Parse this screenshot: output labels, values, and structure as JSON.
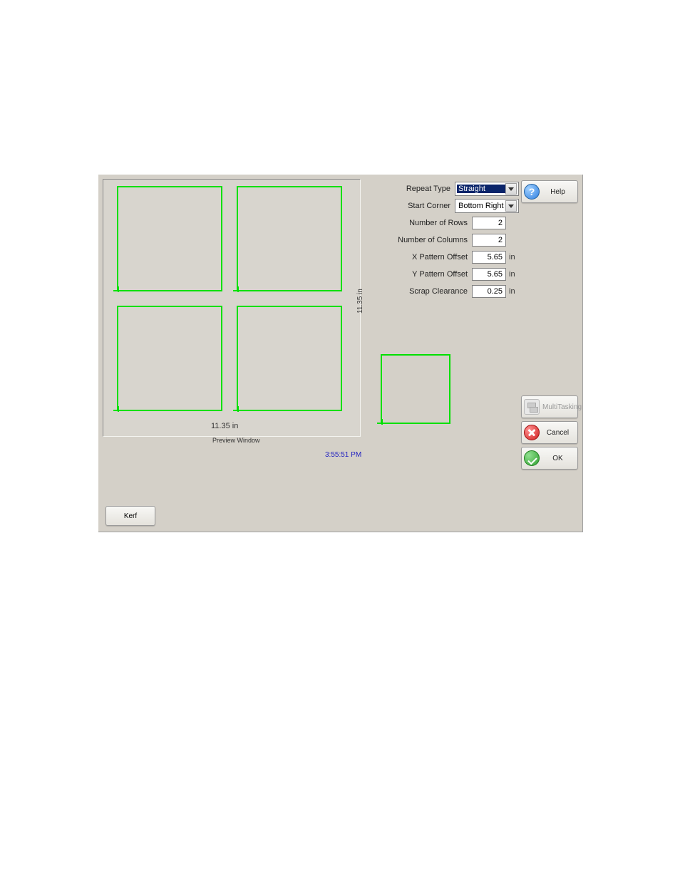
{
  "preview": {
    "x_dimension": "11.35 in",
    "y_dimension": "11.35 in",
    "caption": "Preview Window"
  },
  "timestamp": "3:55:51 PM",
  "form": {
    "repeat_type": {
      "label": "Repeat Type",
      "value": "Straight"
    },
    "start_corner": {
      "label": "Start Corner",
      "value": "Bottom Right"
    },
    "rows": {
      "label": "Number of Rows",
      "value": "2"
    },
    "cols": {
      "label": "Number of Columns",
      "value": "2"
    },
    "x_offset": {
      "label": "X Pattern Offset",
      "value": "5.65",
      "unit": "in"
    },
    "y_offset": {
      "label": "Y Pattern Offset",
      "value": "5.65",
      "unit": "in"
    },
    "scrap": {
      "label": "Scrap Clearance",
      "value": "0.25",
      "unit": "in"
    }
  },
  "buttons": {
    "help": "Help",
    "multitasking": "MultiTasking",
    "cancel": "Cancel",
    "ok": "OK",
    "kerf": "Kerf"
  }
}
